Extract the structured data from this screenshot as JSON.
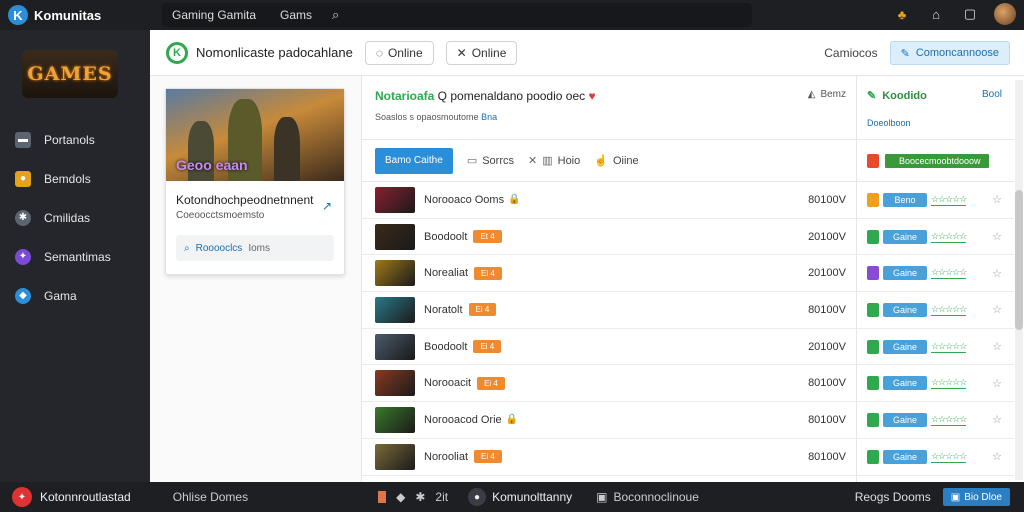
{
  "topbar": {
    "brand": "Komunitas",
    "nav": [
      "Gaming Gamita",
      "Gams"
    ],
    "icons": [
      "search-icon",
      "store-icon",
      "home-icon",
      "window-icon"
    ]
  },
  "sidebar": {
    "logo_text": "GAMES",
    "items": [
      {
        "label": "Portanols",
        "icon": "folder-icon",
        "color": "#5b6470"
      },
      {
        "label": "Bemdols",
        "icon": "controller-icon",
        "color": "#e7a21c"
      },
      {
        "label": "Cmilidas",
        "icon": "gear-icon",
        "color": "#5b6470"
      },
      {
        "label": "Semantimas",
        "icon": "magic-icon",
        "color": "#7a4ad8"
      },
      {
        "label": "Gama",
        "icon": "gamepad-icon",
        "color": "#2a8fd8"
      }
    ]
  },
  "header": {
    "badge": "K",
    "title": "Nomonlicaste padocahlane",
    "btn1": "Online",
    "btn2": "Online",
    "right_link": "Camiocos",
    "right_button": "Comoncannoose"
  },
  "card": {
    "art_label": "Geoo eaan",
    "title": "Kotondhochpeodnetnnent",
    "subtitle": "Coeoocctsmoemsto",
    "search_label": "Rooooclcs",
    "search_placeholder": "Ioms"
  },
  "center": {
    "title_highlight": "Notarioafa",
    "title_rest": " Q pomenaldano poodio oec",
    "right_label": "Bemz",
    "subtitle": "Soaslos s opaosmoutome",
    "subtitle_highlight": "Bna",
    "tabs": {
      "active": "Bamo Caithe",
      "tab2": "Sorrcs",
      "tab3": "Hoio",
      "tab4": "Oiine"
    },
    "rows": [
      {
        "name": "Norooaco Ooms",
        "badge": "",
        "lock": true,
        "count": "80100V",
        "thumb": "#8a2030"
      },
      {
        "name": "Boodoolt",
        "badge": "Et 4",
        "lock": false,
        "count": "20100V",
        "thumb": "#3a2a1a"
      },
      {
        "name": "Norealiat",
        "badge": "Ei 4",
        "lock": false,
        "count": "20100V",
        "thumb": "#a07a1a"
      },
      {
        "name": "Noratolt",
        "badge": "Ei 4",
        "lock": false,
        "count": "80100V",
        "thumb": "#2a7a8a"
      },
      {
        "name": "Boodoolt",
        "badge": "Ei 4",
        "lock": false,
        "count": "20100V",
        "thumb": "#4a5a6a"
      },
      {
        "name": "Norooacit",
        "badge": "Ei 4",
        "lock": false,
        "count": "80100V",
        "thumb": "#8a3a20"
      },
      {
        "name": "Norooacod Orie",
        "badge": "",
        "lock": true,
        "count": "80100V",
        "thumb": "#3a7a2a"
      },
      {
        "name": "Norooliat",
        "badge": "Ei 4",
        "lock": false,
        "count": "80100V",
        "thumb": "#7a6a3a"
      }
    ]
  },
  "rpanel": {
    "title": "Koodido",
    "link": "Bool",
    "subtitle": "Doeolboon",
    "green_label": "Boocecmoobtdooow",
    "rows": [
      {
        "sq": "#f0a020",
        "btn": "Beno",
        "stars": "☆☆☆☆☆"
      },
      {
        "sq": "#2fa84f",
        "btn": "Gaine",
        "stars": "☆☆☆☆☆"
      },
      {
        "sq": "#8a4ad8",
        "btn": "Gaine",
        "stars": "☆☆☆☆☆"
      },
      {
        "sq": "#2fa84f",
        "btn": "Gaine",
        "stars": "☆☆☆☆☆"
      },
      {
        "sq": "#2fa84f",
        "btn": "Gaine",
        "stars": "☆☆☆☆☆"
      },
      {
        "sq": "#2fa84f",
        "btn": "Gaine",
        "stars": "☆☆☆☆☆"
      },
      {
        "sq": "#2fa84f",
        "btn": "Gaine",
        "stars": "☆☆☆☆☆"
      },
      {
        "sq": "#2fa84f",
        "btn": "Gaine",
        "stars": "☆☆☆☆☆"
      }
    ]
  },
  "bottombar": {
    "user": "Kotonnroutlastad",
    "status": "Ohlise Domes",
    "mid_count": "2it",
    "community": "Komunolttanny",
    "message": "Boconnoclinoue",
    "right_label": "Reogs Dooms",
    "right_btn": "Bio Dloe"
  }
}
